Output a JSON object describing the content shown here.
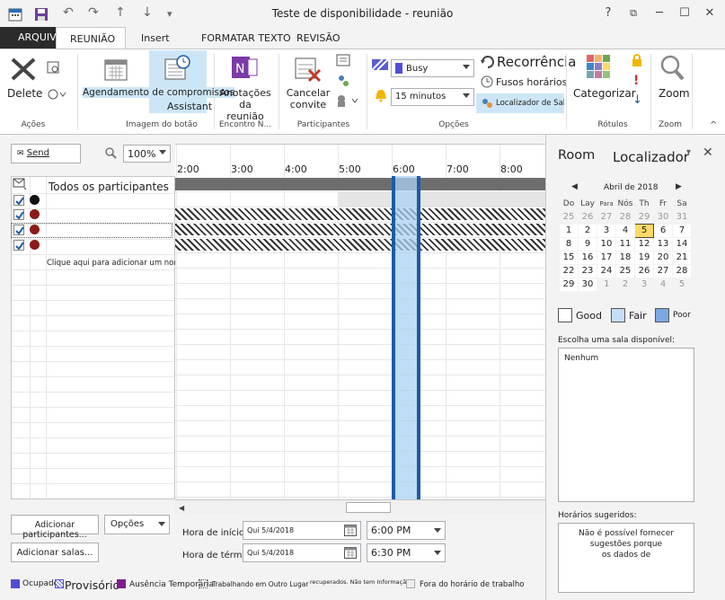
{
  "window": {
    "title": "Teste de disponibilidade - reunião"
  },
  "qat": {
    "undo": "↶",
    "redo": "↷",
    "up": "↑",
    "down": "↓",
    "more": "▾"
  },
  "winctrl": {
    "help": "?",
    "restore": "⧉",
    "min": "─",
    "max": "☐",
    "close": "✕"
  },
  "tabs": {
    "file": "ARQUIVO",
    "meeting": "REUNIÃO",
    "insert": "Insert",
    "format": "FORMATAR TEXTO",
    "review": "REVISÃO"
  },
  "ribbon": {
    "delete": "Delete",
    "acoes": "Ações",
    "agendamento": "Agendamento de compromissos",
    "assistant": "Assistant",
    "imagem": "Imagem do botão",
    "anotacoes1": "Anotações da",
    "anotacoes2": "reunião",
    "encontro": "Encontro N...",
    "cancelar1": "Cancelar",
    "cancelar2": "convite",
    "participantes": "Participantes",
    "busy": "Busy",
    "minutes": "15 minutos",
    "recorrencia": "Recorrência",
    "fusos": "Fusos horários",
    "localizador": "Localizador de Salas",
    "opcoes": "Opções",
    "categorizar": "Categorizar",
    "rotulos": "Rótulos",
    "zoom": "Zoom",
    "zoom_group": "Zoom"
  },
  "toolbar": {
    "send": "Send",
    "zoom_value": "100%"
  },
  "times": [
    "2:00",
    "3:00",
    "4:00",
    "5:00",
    "6:00",
    "7:00",
    "8:00"
  ],
  "attendees": {
    "header": "Todos os participantes",
    "add_hint": "Clique aqui para adicionar um nome"
  },
  "bottom": {
    "add_participants": "Adicionar participantes...",
    "options": "Opções",
    "add_rooms": "Adicionar salas...",
    "start_label": "Hora de início",
    "end_label": "Hora de término",
    "start_date": "Qui 5/4/2018",
    "end_date": "Qui 5/4/2018",
    "start_time": "6:00 PM",
    "end_time": "6:30 PM"
  },
  "legend": {
    "busy": "Ocupado",
    "tentative": "Provisório",
    "oof": "Ausência Temporária",
    "elsewhere": "Trabalhando em Outro Lugar",
    "noinfo": "recuperados. Não tem Informação",
    "outside": "Fora do horário de trabalho"
  },
  "side": {
    "room": "Room",
    "title": "Localizador",
    "month": "Abril de 2018",
    "days": [
      "Do",
      "Lay",
      "Para",
      "Nós",
      "Th",
      "Fr",
      "Sa"
    ],
    "weeks": [
      [
        "25",
        "26",
        "27",
        "28",
        "29",
        "30",
        "31"
      ],
      [
        "1",
        "2",
        "3",
        "4",
        "5",
        "6",
        "7"
      ],
      [
        "8",
        "9",
        "10",
        "11",
        "12",
        "13",
        "14"
      ],
      [
        "15",
        "16",
        "17",
        "18",
        "19",
        "20",
        "21"
      ],
      [
        "22",
        "23",
        "24",
        "25",
        "26",
        "27",
        "28"
      ],
      [
        "29",
        "30",
        "1",
        "2",
        "3",
        "4",
        "5"
      ]
    ],
    "good": "Good",
    "fair": "Fair",
    "poor": "Poor",
    "choose_room": "Escolha uma sala disponível:",
    "none": "Nenhum",
    "suggested": "Horários sugeridos:",
    "msg1": "Não é possível fornecer",
    "msg2": "sugestões porque",
    "msg3": "os dados de"
  },
  "colors": {
    "selection": "#cde6f7",
    "busy_blue": "#4f4fd6",
    "oof_purple": "#7b1e8a",
    "accent": "#1e5aa8"
  }
}
